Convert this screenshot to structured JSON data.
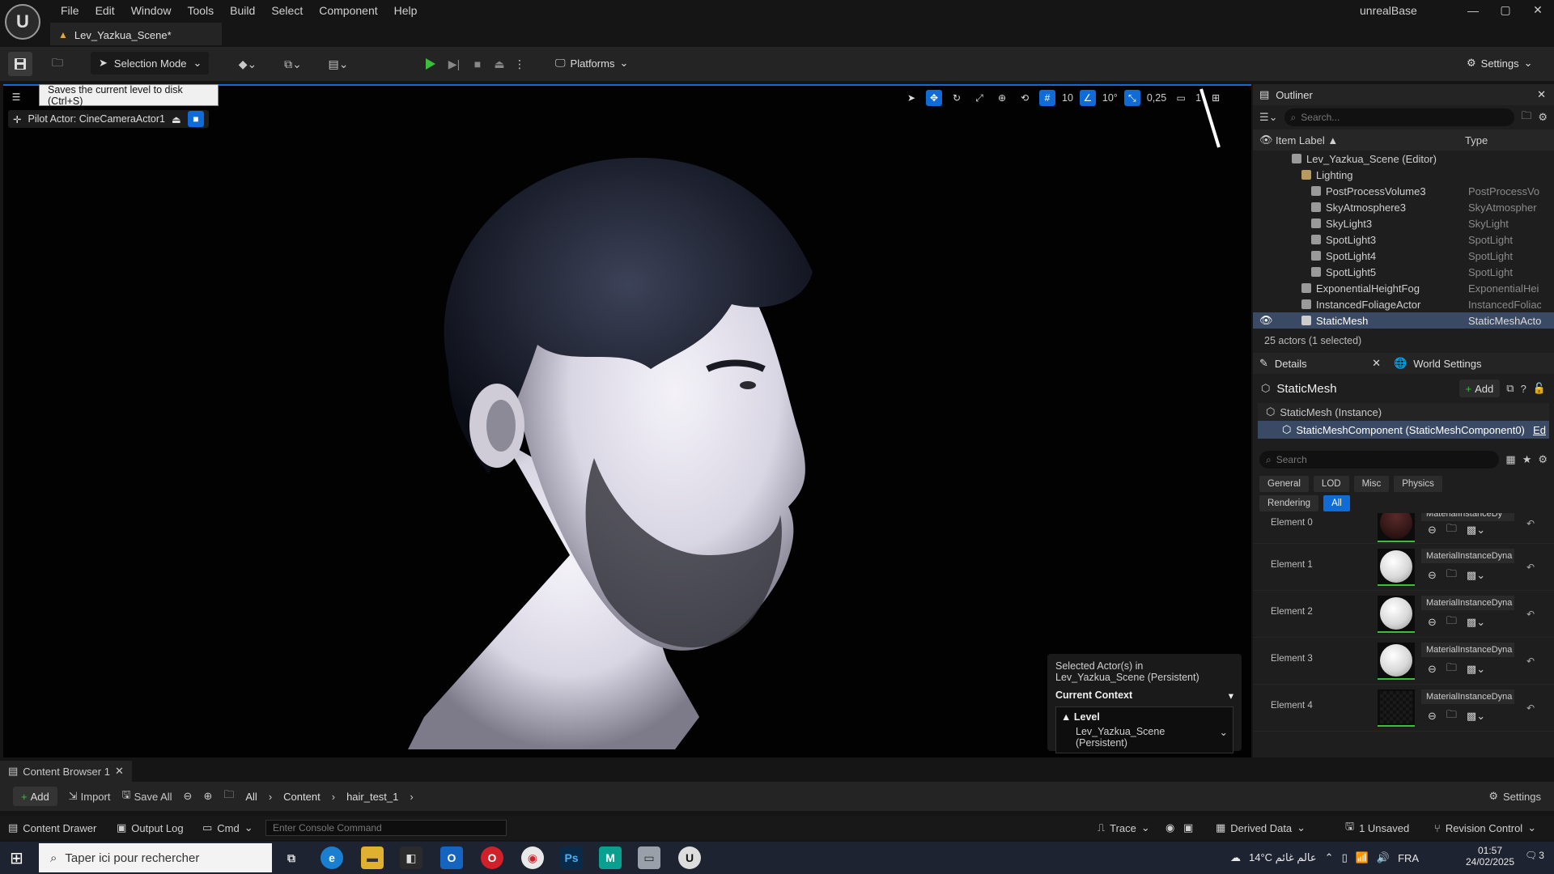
{
  "app": {
    "title": "unrealBase",
    "logo": "U",
    "minimize": "—",
    "maximize": "▢",
    "close": "✕"
  },
  "menu": [
    "File",
    "Edit",
    "Window",
    "Tools",
    "Build",
    "Select",
    "Component",
    "Help"
  ],
  "level_tab": {
    "label": "Lev_Yazkua_Scene*"
  },
  "toolbar": {
    "selection_mode": "Selection Mode",
    "platforms": "Platforms",
    "settings": "Settings"
  },
  "tooltip": "Saves the current level to disk (Ctrl+S)",
  "viewport": {
    "pilot_actor": "Pilot Actor: CineCameraActor1",
    "grid_size": "10",
    "rotation_snap": "10°",
    "scale_snap": "0,25",
    "camera_speed": "1",
    "selected_actors_line1": "Selected Actor(s) in",
    "selected_actors_line2": "Lev_Yazkua_Scene (Persistent)",
    "current_context": "Current Context",
    "level_label": "Level",
    "level_value": "Lev_Yazkua_Scene (Persistent)"
  },
  "outliner": {
    "title": "Outliner",
    "search_placeholder": "Search...",
    "col_label": "Item Label ▲",
    "col_type": "Type",
    "rows": [
      {
        "label": "Lev_Yazkua_Scene (Editor)",
        "type": ""
      },
      {
        "label": "Lighting",
        "type": ""
      },
      {
        "label": "PostProcessVolume3",
        "type": "PostProcessVo"
      },
      {
        "label": "SkyAtmosphere3",
        "type": "SkyAtmospher"
      },
      {
        "label": "SkyLight3",
        "type": "SkyLight"
      },
      {
        "label": "SpotLight3",
        "type": "SpotLight"
      },
      {
        "label": "SpotLight4",
        "type": "SpotLight"
      },
      {
        "label": "SpotLight5",
        "type": "SpotLight"
      },
      {
        "label": "ExponentialHeightFog",
        "type": "ExponentialHei"
      },
      {
        "label": "InstancedFoliageActor",
        "type": "InstancedFoliac"
      },
      {
        "label": "StaticMesh",
        "type": "StaticMeshActo"
      }
    ],
    "count": "25 actors (1 selected)"
  },
  "details": {
    "title": "Details",
    "world_settings": "World Settings",
    "actor_name": "StaticMesh",
    "add": "Add",
    "instance": "StaticMesh (Instance)",
    "component": "StaticMeshComponent (StaticMeshComponent0)",
    "component_edit": "Ed",
    "search_placeholder": "Search",
    "chips": [
      "General",
      "LOD",
      "Misc",
      "Physics",
      "Rendering",
      "All"
    ],
    "elements": [
      {
        "label": "Element 0",
        "material": "MaterialInstanceDy"
      },
      {
        "label": "Element 1",
        "material": "MaterialInstanceDyna"
      },
      {
        "label": "Element 2",
        "material": "MaterialInstanceDyna"
      },
      {
        "label": "Element 3",
        "material": "MaterialInstanceDyna"
      },
      {
        "label": "Element 4",
        "material": "MaterialInstanceDyna"
      }
    ]
  },
  "content_browser": {
    "tab": "Content Browser 1",
    "add": "Add",
    "import": "Import",
    "save_all": "Save All",
    "crumbs": [
      "All",
      "Content",
      "hair_test_1"
    ],
    "settings": "Settings"
  },
  "status": {
    "content_drawer": "Content Drawer",
    "output_log": "Output Log",
    "cmd": "Cmd",
    "console_placeholder": "Enter Console Command",
    "trace": "Trace",
    "derived_data": "Derived Data",
    "unsaved": "1 Unsaved",
    "revision_control": "Revision Control"
  },
  "taskbar": {
    "search_placeholder": "Taper ici pour rechercher",
    "weather": "14°C  عالم غائم",
    "lang": "FRA",
    "time": "01:57",
    "date": "24/02/2025",
    "notif": "3"
  },
  "colors": {
    "accent": "#0f6bd6",
    "play": "#3bbf3b",
    "warning": "#e8a33a"
  }
}
